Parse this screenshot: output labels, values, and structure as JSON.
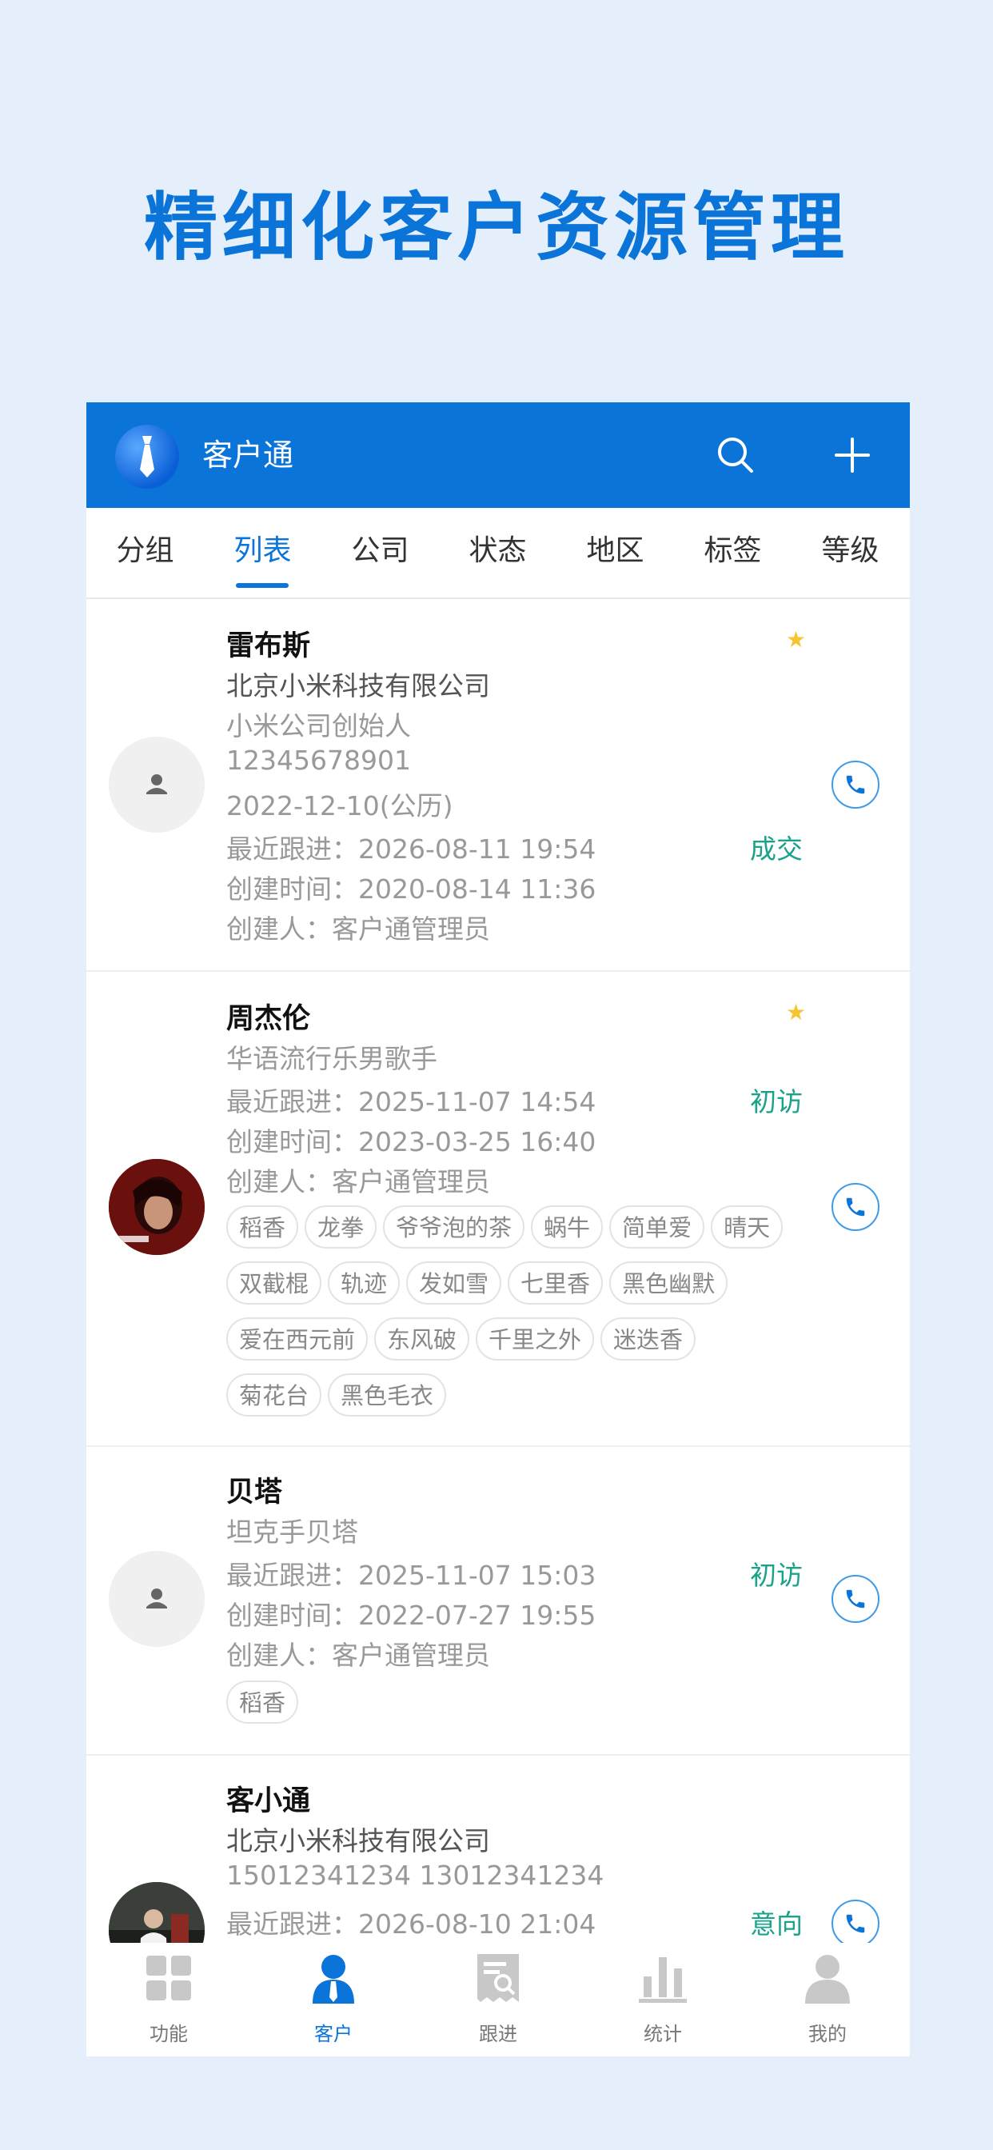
{
  "promo": {
    "title": "精细化客户资源管理"
  },
  "appbar": {
    "title": "客户通",
    "logo_icon": "tie-logo-icon",
    "search_icon": "search-icon",
    "add_icon": "plus-icon"
  },
  "tabs": [
    {
      "label": "分组"
    },
    {
      "label": "列表",
      "active": true
    },
    {
      "label": "公司"
    },
    {
      "label": "状态"
    },
    {
      "label": "地区"
    },
    {
      "label": "标签"
    },
    {
      "label": "等级"
    }
  ],
  "customers": [
    {
      "name": "雷布斯",
      "company": "北京小米科技有限公司",
      "title": "小米公司创始人",
      "phone": "12345678901",
      "birthday": "2022-12-10(公历)",
      "recent": "最近跟进：2026-08-11 19:54",
      "created": "创建时间：2020-08-14 11:36",
      "creator": "创建人：客户通管理员",
      "status": "成交",
      "starred": true
    },
    {
      "name": "周杰伦",
      "title": "华语流行乐男歌手",
      "recent": "最近跟进：2025-11-07 14:54",
      "created": "创建时间：2023-03-25 16:40",
      "creator": "创建人：客户通管理员",
      "status": "初访",
      "starred": true,
      "tags": [
        "稻香",
        "龙拳",
        "爷爷泡的茶",
        "蜗牛",
        "简单爱",
        "晴天",
        "双截棍",
        "轨迹",
        "发如雪",
        "七里香",
        "黑色幽默",
        "爱在西元前",
        "东风破",
        "千里之外",
        "迷迭香",
        "菊花台",
        "黑色毛衣"
      ]
    },
    {
      "name": "贝塔",
      "title": "坦克手贝塔",
      "recent": "最近跟进：2025-11-07 15:03",
      "created": "创建时间：2022-07-27 19:55",
      "creator": "创建人：客户通管理员",
      "status": "初访",
      "tags": [
        "稻香"
      ]
    },
    {
      "name": "客小通",
      "company": "北京小米科技有限公司",
      "phone": "15012341234 13012341234",
      "recent": "最近跟进：2026-08-10 21:04",
      "status": "意向"
    }
  ],
  "bottom_nav": [
    {
      "label": "功能",
      "icon": "grid-icon"
    },
    {
      "label": "客户",
      "icon": "person-icon",
      "active": true
    },
    {
      "label": "跟进",
      "icon": "receipt-search-icon"
    },
    {
      "label": "统计",
      "icon": "bar-chart-icon"
    },
    {
      "label": "我的",
      "icon": "user-icon"
    }
  ],
  "colors": {
    "brand": "#0a74d8",
    "status": "#1aa28a",
    "star": "#f6c431",
    "background": "#e4effb"
  }
}
